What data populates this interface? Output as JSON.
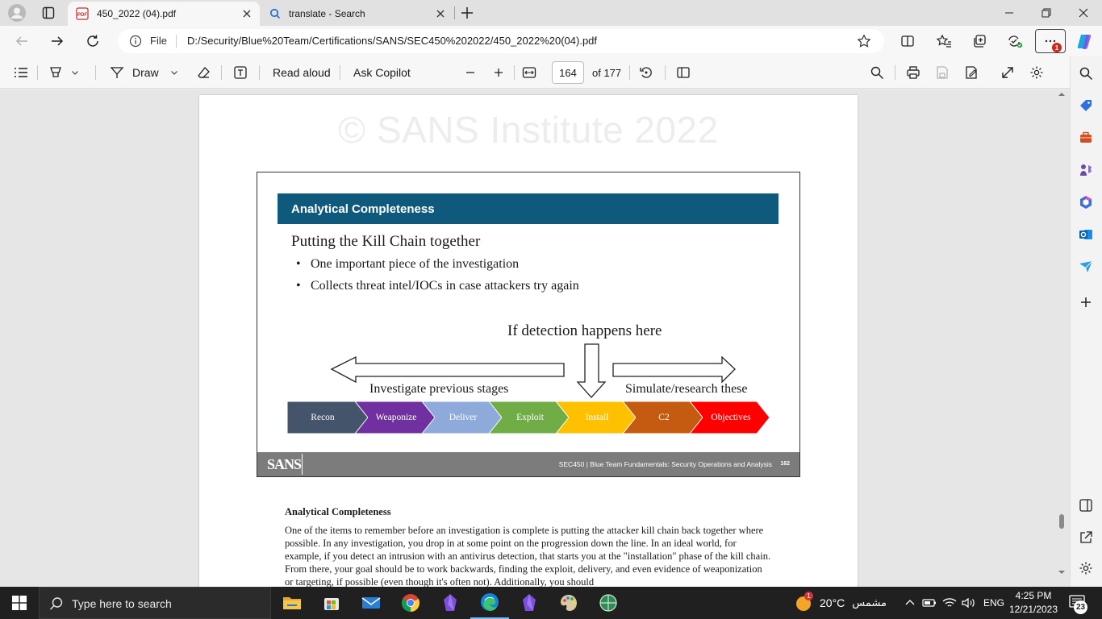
{
  "browser": {
    "tabs": [
      {
        "title": "450_2022 (04).pdf",
        "icon": "pdf-icon",
        "active": true
      },
      {
        "title": "translate - Search",
        "icon": "search-icon",
        "active": false
      }
    ],
    "address": {
      "scheme_label": "File",
      "url": "D:/Security/Blue%20Team/Certifications/SANS/SEC450%202022/450_2022%20(04).pdf"
    },
    "badge_count": "1"
  },
  "pdf_toolbar": {
    "draw_label": "Draw",
    "read_aloud_label": "Read aloud",
    "ask_copilot_label": "Ask Copilot",
    "page_current": "164",
    "page_total_label": "of 177"
  },
  "document": {
    "watermark": "© SANS Institute 2022",
    "slide": {
      "header": "Analytical Completeness",
      "title": "Putting the Kill Chain together",
      "bullets": [
        "One important piece of the investigation",
        "Collects threat intel/IOCs in case attackers try again"
      ],
      "detection_label": "If detection happens here",
      "left_label": "Investigate previous stages",
      "right_label": "Simulate/research these",
      "kill_chain": [
        {
          "name": "Recon",
          "color": "#44546a"
        },
        {
          "name": "Weaponize",
          "color": "#7030a0"
        },
        {
          "name": "Deliver",
          "color": "#8eaadb"
        },
        {
          "name": "Exploit",
          "color": "#70ad47"
        },
        {
          "name": "Install",
          "color": "#ffc000"
        },
        {
          "name": "C2",
          "color": "#c55a11"
        },
        {
          "name": "Objectives",
          "color": "#ff0000"
        }
      ],
      "footer_logo": "SANS",
      "footer_text": "SEC450 | Blue Team Fundamentals: Security Operations and Analysis",
      "footer_page": "162"
    },
    "body_heading": "Analytical Completeness",
    "body_text": "One of the items to remember before an investigation is complete is putting the attacker kill chain back together where possible. In any investigation, you drop in at some point on the progression down the line. In an ideal world, for example, if you detect an intrusion with an antivirus detection, that starts you at the \"installation\" phase of the kill chain. From there, your goal should be to work backwards, finding the exploit, delivery, and even evidence of weaponization or targeting, if possible (even though it's often not). Additionally, you should"
  },
  "taskbar": {
    "search_placeholder": "Type here to search",
    "weather_temp": "20°C",
    "weather_desc": "مشمس",
    "weather_badge": "1",
    "language": "ENG",
    "time": "4:25 PM",
    "date": "12/21/2023",
    "notification_count": "23"
  }
}
